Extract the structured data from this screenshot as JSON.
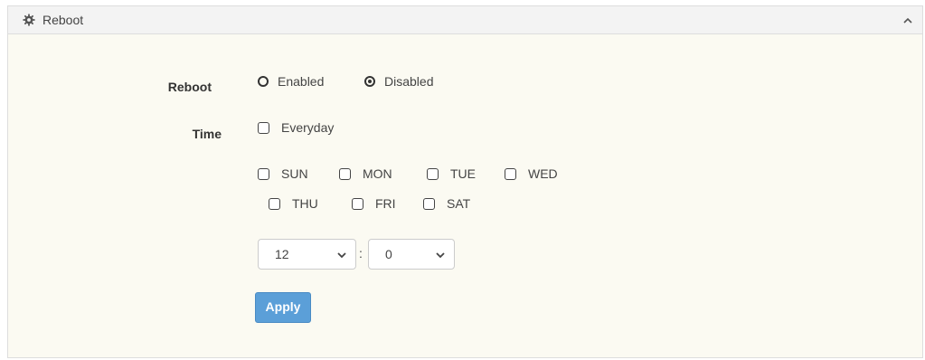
{
  "panel": {
    "title": "Reboot",
    "gear_icon": "gear-icon",
    "collapse_icon": "chevron-up-icon"
  },
  "reboot": {
    "label": "Reboot",
    "options": [
      {
        "label": "Enabled",
        "checked": false
      },
      {
        "label": "Disabled",
        "checked": true
      }
    ]
  },
  "time": {
    "label": "Time",
    "everyday_label": "Everyday",
    "days": [
      "SUN",
      "MON",
      "TUE",
      "WED",
      "THU",
      "FRI",
      "SAT"
    ],
    "hour_value": "12",
    "minute_value": "0",
    "separator": ":"
  },
  "apply_label": "Apply",
  "colors": {
    "apply_button": "#5b9fd8",
    "panel_background": "#fbfaf2",
    "header_background": "#f3f3f3"
  }
}
